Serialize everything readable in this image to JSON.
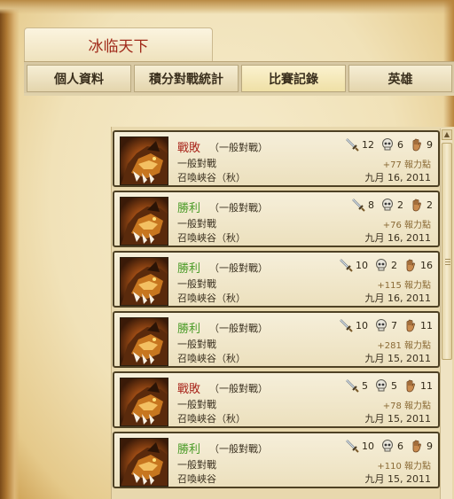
{
  "title_tab": "冰临天下",
  "tabs": [
    {
      "label": "個人資料",
      "active": false
    },
    {
      "label": "積分對戰統計",
      "active": false
    },
    {
      "label": "比賽記錄",
      "active": true
    },
    {
      "label": "英雄",
      "active": false
    }
  ],
  "colors": {
    "lose": "#a8241a",
    "win": "#4a9b27",
    "title": "#a02a1a"
  },
  "matches": [
    {
      "result": "戰敗",
      "outcome": "lose",
      "queue": "（一般對戰）",
      "mode": "一般對戰",
      "map": "召喚峽谷（秋）",
      "kills": "12",
      "deaths": "6",
      "assists": "9",
      "ip": "+77 報力點",
      "date": "九月 16, 2011",
      "icons": [
        "sword-icon",
        "skull-icon",
        "hand-icon"
      ]
    },
    {
      "result": "勝利",
      "outcome": "win",
      "queue": "（一般對戰）",
      "mode": "一般對戰",
      "map": "召喚峽谷（秋）",
      "kills": "8",
      "deaths": "2",
      "assists": "2",
      "ip": "+76 報力點",
      "date": "九月 16, 2011",
      "icons": [
        "sword-icon",
        "skull-icon",
        "hand-icon"
      ]
    },
    {
      "result": "勝利",
      "outcome": "win",
      "queue": "（一般對戰）",
      "mode": "一般對戰",
      "map": "召喚峽谷（秋）",
      "kills": "10",
      "deaths": "2",
      "assists": "16",
      "ip": "+115 報力點",
      "date": "九月 16, 2011",
      "icons": [
        "sword-icon",
        "skull-icon",
        "hand-icon"
      ]
    },
    {
      "result": "勝利",
      "outcome": "win",
      "queue": "（一般對戰）",
      "mode": "一般對戰",
      "map": "召喚峽谷（秋）",
      "kills": "10",
      "deaths": "7",
      "assists": "11",
      "ip": "+281 報力點",
      "date": "九月 15, 2011",
      "icons": [
        "sword-icon",
        "skull-icon",
        "hand-icon"
      ]
    },
    {
      "result": "戰敗",
      "outcome": "lose",
      "queue": "（一般對戰）",
      "mode": "一般對戰",
      "map": "召喚峽谷（秋）",
      "kills": "5",
      "deaths": "5",
      "assists": "11",
      "ip": "+78 報力點",
      "date": "九月 15, 2011",
      "icons": [
        "sword-icon",
        "skull-icon",
        "hand-icon"
      ]
    },
    {
      "result": "勝利",
      "outcome": "win",
      "queue": "（一般對戰）",
      "mode": "一般對戰",
      "map": "召喚峽谷",
      "kills": "10",
      "deaths": "6",
      "assists": "9",
      "ip": "+110 報力點",
      "date": "九月 15, 2011",
      "icons": [
        "sword-icon",
        "skull-icon",
        "hand-icon"
      ]
    }
  ]
}
